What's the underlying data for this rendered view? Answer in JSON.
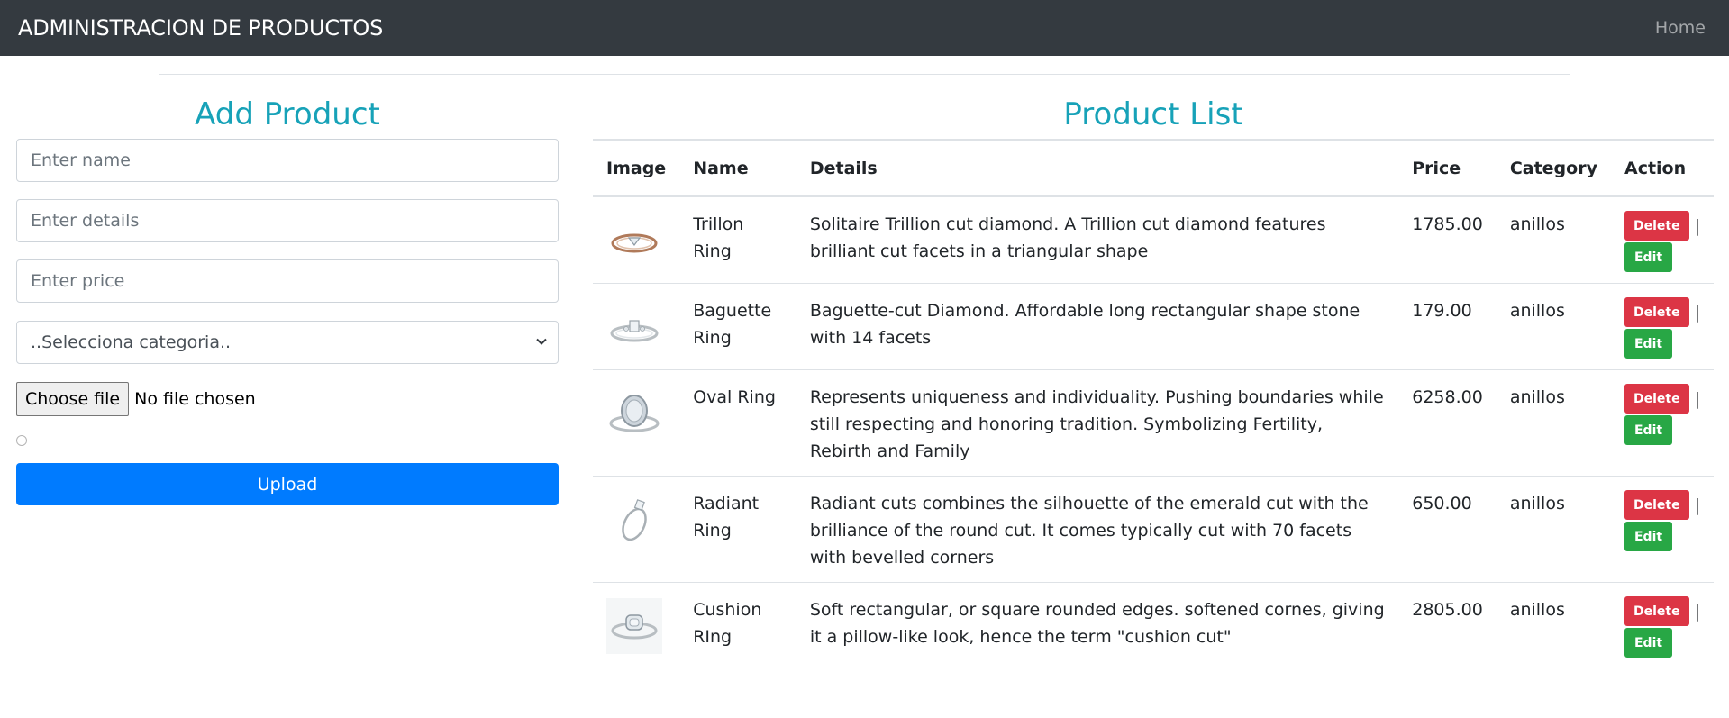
{
  "navbar": {
    "brand": "ADMINISTRACION DE PRODUCTOS",
    "home_link": "Home"
  },
  "form": {
    "title": "Add Product",
    "name_placeholder": "Enter name",
    "details_placeholder": "Enter details",
    "price_placeholder": "Enter price",
    "category_selected": "..Selecciona categoria..",
    "file_button": "Choose file",
    "file_status": "No file chosen",
    "upload_label": "Upload"
  },
  "list": {
    "title": "Product List",
    "headers": [
      "Image",
      "Name",
      "Details",
      "Price",
      "Category",
      "Action"
    ],
    "delete_label": "Delete",
    "edit_label": "Edit",
    "separator": "|",
    "rows": [
      {
        "name": "Trillon Ring",
        "details": "Solitaire Trillion cut diamond. A Trillion cut diamond features brilliant cut facets in a triangular shape",
        "price": "1785.00",
        "category": "anillos",
        "image": "ring-trillion-icon"
      },
      {
        "name": "Baguette Ring",
        "details": "Baguette-cut Diamond. Affordable long rectangular shape stone with 14 facets",
        "price": "179.00",
        "category": "anillos",
        "image": "ring-baguette-icon"
      },
      {
        "name": "Oval Ring",
        "details": "Represents uniqueness and individuality. Pushing boundaries while still respecting and honoring tradition. Symbolizing Fertility, Rebirth and Family",
        "price": "6258.00",
        "category": "anillos",
        "image": "ring-oval-icon"
      },
      {
        "name": "Radiant Ring",
        "details": "Radiant cuts combines the silhouette of the emerald cut with the brilliance of the round cut. It comes typically cut with 70 facets with bevelled corners",
        "price": "650.00",
        "category": "anillos",
        "image": "ring-radiant-icon"
      },
      {
        "name": "Cushion RIng",
        "details": "Soft rectangular, or square rounded edges. softened cornes, giving it a pillow-like look, hence the term \"cushion cut\"",
        "price": "2805.00",
        "category": "anillos",
        "image": "ring-cushion-icon"
      }
    ]
  },
  "colors": {
    "navbar": "#343a40",
    "heading": "#17a2b8",
    "primary": "#007bff",
    "danger": "#dc3545",
    "success": "#28a745"
  }
}
